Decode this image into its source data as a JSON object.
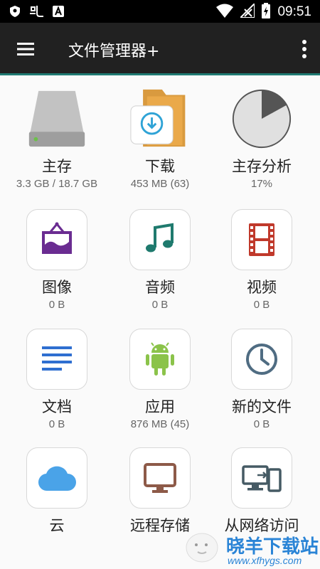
{
  "status_bar": {
    "time": "09:51",
    "icons": [
      "shield-icon",
      "app-icon",
      "font-a-icon",
      "wifi-icon",
      "signal-icon",
      "battery-charging-icon"
    ]
  },
  "app_bar": {
    "title": "文件管理器+"
  },
  "tiles": [
    {
      "label": "主存",
      "sub": "3.3 GB / 18.7 GB",
      "icon": "drive-icon"
    },
    {
      "label": "下载",
      "sub": "453 MB (63)",
      "icon": "download-folder-icon"
    },
    {
      "label": "主存分析",
      "sub": "17%",
      "icon": "pie-chart-icon"
    },
    {
      "label": "图像",
      "sub": "0 B",
      "icon": "image-icon"
    },
    {
      "label": "音频",
      "sub": "0 B",
      "icon": "music-icon"
    },
    {
      "label": "视频",
      "sub": "0 B",
      "icon": "film-icon"
    },
    {
      "label": "文档",
      "sub": "0 B",
      "icon": "document-icon"
    },
    {
      "label": "应用",
      "sub": "876 MB (45)",
      "icon": "android-icon"
    },
    {
      "label": "新的文件",
      "sub": "0 B",
      "icon": "clock-icon"
    },
    {
      "label": "云",
      "sub": "",
      "icon": "cloud-icon"
    },
    {
      "label": "远程存储",
      "sub": "",
      "icon": "monitor-icon"
    },
    {
      "label": "从网络访问",
      "sub": "",
      "icon": "devices-icon"
    }
  ],
  "storage_analysis_percent": 17,
  "watermark": {
    "title": "晓羊下载站",
    "url": "www.xfhygs.com"
  },
  "colors": {
    "appbar": "#212121",
    "accent": "#1f7a73",
    "image": "#6a2c91",
    "music": "#1f7a6e",
    "video": "#c0392b",
    "document": "#2f6fd0",
    "android": "#8bc34a",
    "clock": "#4f6c82",
    "cloud": "#4aa3e8",
    "monitor": "#8d5a48",
    "devices": "#455a64"
  }
}
